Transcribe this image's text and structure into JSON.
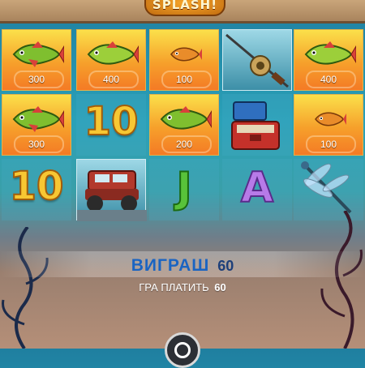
{
  "logo": {
    "text": "SPLASH!"
  },
  "reels": [
    {
      "cells": [
        {
          "kind": "fish",
          "value": "300"
        },
        {
          "kind": "fish",
          "value": "300"
        },
        {
          "kind": "bigten",
          "text": "10"
        }
      ]
    },
    {
      "cells": [
        {
          "kind": "fish",
          "value": "400"
        },
        {
          "kind": "bigten",
          "text": "10"
        },
        {
          "kind": "truck"
        }
      ]
    },
    {
      "cells": [
        {
          "kind": "fish-small",
          "value": "100"
        },
        {
          "kind": "fish",
          "value": "200"
        },
        {
          "kind": "letter",
          "text": "J"
        }
      ]
    },
    {
      "cells": [
        {
          "kind": "rod"
        },
        {
          "kind": "tackle-box"
        },
        {
          "kind": "letter",
          "text": "A"
        }
      ]
    },
    {
      "cells": [
        {
          "kind": "fish",
          "value": "400"
        },
        {
          "kind": "fish-small",
          "value": "100"
        },
        {
          "kind": "dragonfly"
        }
      ]
    }
  ],
  "win": {
    "label": "ВИГРАШ",
    "amount": "60"
  },
  "pay": {
    "label": "ГРА ПЛАТИТЬ",
    "amount": "60"
  },
  "colors": {
    "win_label": "#1a64c2",
    "fish_bg_top": "#fbe04a",
    "fish_bg_bottom": "#f47a25"
  }
}
